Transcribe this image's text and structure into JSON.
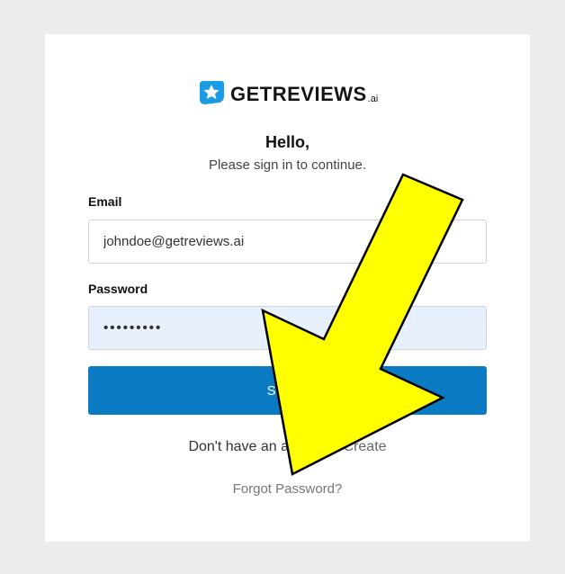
{
  "brand": {
    "name": "GETREVIEWS",
    "suffix": ".ai",
    "badge_color": "#1a9be6"
  },
  "form": {
    "greeting": "Hello,",
    "subtitle": "Please sign in to continue.",
    "email_label": "Email",
    "email_value": "johndoe@getreviews.ai",
    "password_label": "Password",
    "password_value": "•••••••••",
    "submit_label": "Sign in",
    "signup_prompt": "Don't have an account?",
    "signup_link": "Create",
    "forgot_link": "Forgot Password?"
  },
  "annotation": {
    "arrow_color": "#ffff00",
    "arrow_outline": "#000000"
  },
  "colors": {
    "page_bg": "#ececec",
    "card_bg": "#ffffff",
    "primary": "#0a7bc2",
    "autofill_bg": "#e8f0fe"
  }
}
